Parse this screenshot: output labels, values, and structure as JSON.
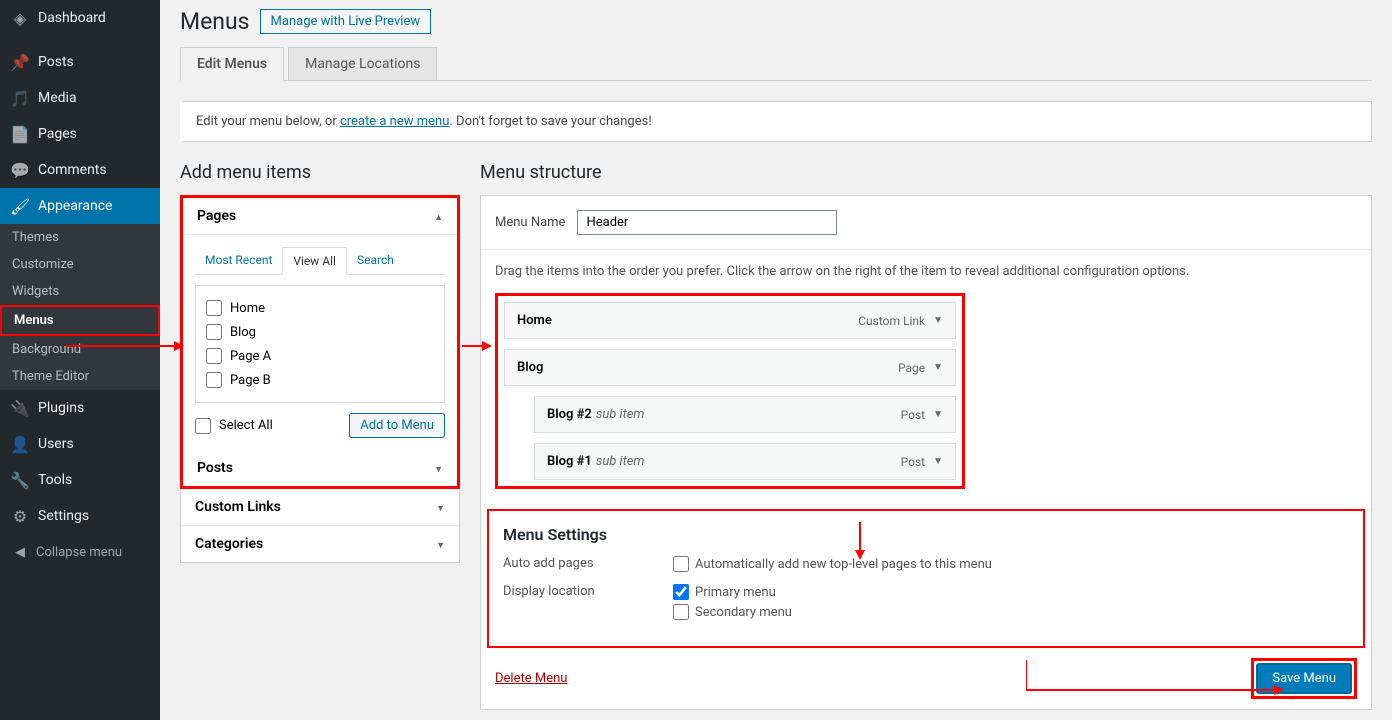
{
  "sidebar": {
    "items": [
      {
        "label": "Dashboard",
        "icon": "⚙"
      },
      {
        "label": "Posts",
        "icon": "✎"
      },
      {
        "label": "Media",
        "icon": "🖾"
      },
      {
        "label": "Pages",
        "icon": "▤"
      },
      {
        "label": "Comments",
        "icon": "💬"
      },
      {
        "label": "Appearance",
        "icon": "🖌"
      },
      {
        "label": "Plugins",
        "icon": "🔌"
      },
      {
        "label": "Users",
        "icon": "👤"
      },
      {
        "label": "Tools",
        "icon": "🔧"
      },
      {
        "label": "Settings",
        "icon": "⚙"
      }
    ],
    "appearance_sub": [
      {
        "label": "Themes"
      },
      {
        "label": "Customize"
      },
      {
        "label": "Widgets"
      },
      {
        "label": "Menus"
      },
      {
        "label": "Background"
      },
      {
        "label": "Theme Editor"
      }
    ],
    "collapse": "Collapse menu"
  },
  "header": {
    "title": "Menus",
    "live_preview": "Manage with Live Preview"
  },
  "tabs": {
    "edit": "Edit Menus",
    "locations": "Manage Locations"
  },
  "notice": {
    "pre": "Edit your menu below, or ",
    "link": "create a new menu",
    "post": ". Don't forget to save your changes!"
  },
  "add_items": {
    "title": "Add menu items",
    "pages": {
      "title": "Pages",
      "tabs": {
        "recent": "Most Recent",
        "view_all": "View All",
        "search": "Search"
      },
      "items": [
        "Home",
        "Blog",
        "Page A",
        "Page B"
      ],
      "select_all": "Select All",
      "add_btn": "Add to Menu"
    },
    "posts": "Posts",
    "custom": "Custom Links",
    "categories": "Categories"
  },
  "structure": {
    "title": "Menu structure",
    "name_label": "Menu Name",
    "name_value": "Header",
    "hint": "Drag the items into the order you prefer. Click the arrow on the right of the item to reveal additional configuration options.",
    "items": [
      {
        "label": "Home",
        "type": "Custom Link",
        "indent": 0
      },
      {
        "label": "Blog",
        "type": "Page",
        "indent": 0
      },
      {
        "label": "Blog #2",
        "sub": "sub item",
        "type": "Post",
        "indent": 1
      },
      {
        "label": "Blog #1",
        "sub": "sub item",
        "type": "Post",
        "indent": 1
      }
    ]
  },
  "settings": {
    "title": "Menu Settings",
    "auto_label": "Auto add pages",
    "auto_opt": "Automatically add new top-level pages to this menu",
    "loc_label": "Display location",
    "loc_primary": "Primary menu",
    "loc_secondary": "Secondary menu"
  },
  "footer": {
    "delete": "Delete Menu",
    "save": "Save Menu"
  }
}
